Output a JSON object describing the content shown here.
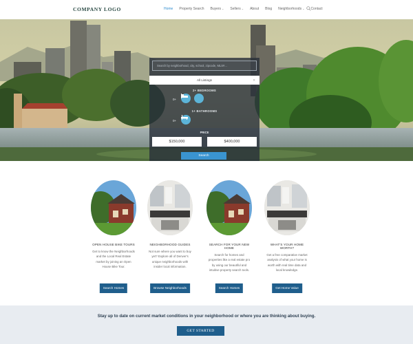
{
  "header": {
    "logo": "COMPANY LOGO",
    "nav": [
      {
        "label": "Home",
        "active": true,
        "caret": false
      },
      {
        "label": "Property Search",
        "active": false,
        "caret": false
      },
      {
        "label": "Buyers",
        "active": false,
        "caret": true
      },
      {
        "label": "Sellers",
        "active": false,
        "caret": true
      },
      {
        "label": "About",
        "active": false,
        "caret": false
      },
      {
        "label": "Blog",
        "active": false,
        "caret": false
      },
      {
        "label": "Neighborhoods",
        "active": false,
        "caret": true
      },
      {
        "label": "Contact",
        "active": false,
        "caret": false
      }
    ],
    "caret_glyph": "⌄",
    "search_icon": "search-icon"
  },
  "search": {
    "placeholder": "Search by neighborhood, city, school, zipcode, MLS#...",
    "listing_select": "All Listings",
    "listing_clear": "✕",
    "bedrooms_label": "2+ BEDROOMS",
    "bathrooms_label": "1+ BATHROOMS",
    "zero_label": "0+",
    "price_label": "PRICE",
    "price_min": "$150,000",
    "price_max": "$400,000",
    "submit_label": "Search",
    "accent_color": "#5cb4d8"
  },
  "features": [
    {
      "title": "OPEN HOUSE BIKE TOURS",
      "desc": "Get to know the Neighborhoods and the Local Real Estate market by joining an Open House Bike Tour.",
      "button": "Search Homes",
      "image": "house-exterior"
    },
    {
      "title": "NEIGHBORHOOD GUIDES",
      "desc": "Not sure where you want to buy yet? Explore all of Denver's unique neighborhoods with insider local information.",
      "button": "Browse Neighborhoods",
      "image": "kitchen-interior"
    },
    {
      "title": "SEARCH FOR YOUR NEW HOME",
      "desc": "Search for homes and properties like a real estate pro by using our beautiful and intuitive property search tools.",
      "button": "Search Homes",
      "image": "house-exterior"
    },
    {
      "title": "WHAT'S YOUR HOME WORTH?",
      "desc": "Get a free comparative market analysis of what your home is worth with real time data and local knowledge.",
      "button": "Get Home Value",
      "image": "kitchen-interior"
    }
  ],
  "cta": {
    "message": "Stay up to date on current market conditions in your neighborhood or where you are thinking about buying.",
    "button": "GET STARTED",
    "band_color": "#e8ecf1",
    "button_color": "#1f5e8c"
  }
}
